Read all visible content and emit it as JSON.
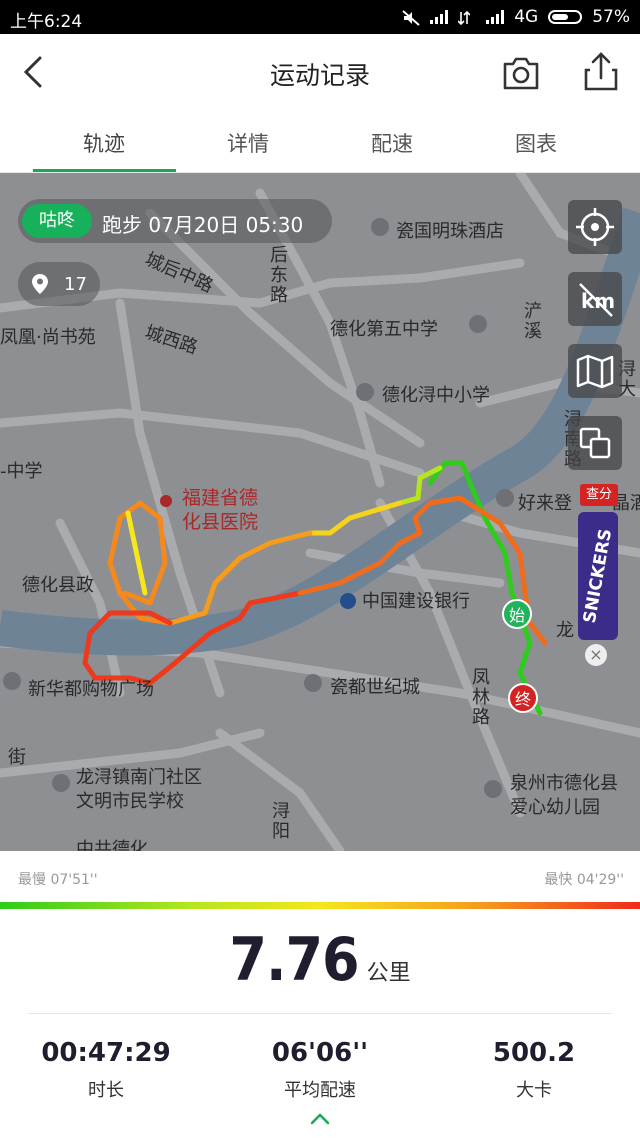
{
  "status_bar": {
    "time": "上午6:24",
    "network": "4G",
    "battery": "57%"
  },
  "header": {
    "title": "运动记录",
    "back_icon": "back-arrow-icon",
    "camera_icon": "camera-icon",
    "share_icon": "share-icon"
  },
  "tabs": [
    {
      "label": "轨迹",
      "active": true
    },
    {
      "label": "详情"
    },
    {
      "label": "配速"
    },
    {
      "label": "图表"
    }
  ],
  "map": {
    "info": {
      "badge": "咕咚",
      "text": "跑步  07月20日 05:30"
    },
    "pin_count": "17",
    "labels": {
      "l1": "瓷国明珠酒店",
      "l2": "城后中路",
      "l3": "后东路",
      "l4": "城西路",
      "l5": "凤凰·尚书苑",
      "l6": "德化第五中学",
      "l7": "浐溪",
      "l8": "德化浔中小学",
      "l9": "-中学",
      "l10": "福建省德",
      "l11": "化县医院",
      "l12": "好来登",
      "l13": "浔南路",
      "l14": "德化县政",
      "l15": "中国建设银行",
      "l16": "新华都购物广场",
      "l17": "瓷都世纪城",
      "l18": "凤林路",
      "l19": "龙浔镇南门社区",
      "l20": "文明市民学校",
      "l21": "泉州市德化县",
      "l22": "爱心幼儿园",
      "l23": "浔阳",
      "l24": "中共德化",
      "l25": "晶酒",
      "l26": "龙",
      "l27": "街",
      "l28": "浔大"
    },
    "start_marker": "始",
    "end_marker": "终",
    "ad": {
      "tag": "查分",
      "brand": "SNICKERS"
    }
  },
  "pace_legend": {
    "slowest": "最慢 07'51''",
    "fastest": "最快 04'29''"
  },
  "summary": {
    "distance": "7.76",
    "distance_unit": "公里",
    "duration": {
      "value": "00:47:29",
      "label": "时长"
    },
    "avg_pace": {
      "value": "06'06''",
      "label": "平均配速"
    },
    "calories": {
      "value": "500.2",
      "label": "大卡"
    }
  },
  "colors": {
    "accent": "#16a95a",
    "map_bg": "#8d8f92",
    "start_marker": "#22b25b",
    "end_marker": "#d32323"
  }
}
